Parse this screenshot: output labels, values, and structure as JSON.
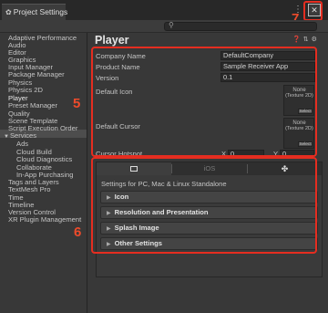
{
  "window": {
    "tab_title": "Project Settings",
    "tab_icon": "gear-icon",
    "menu_glyph": "⋮",
    "close_glyph": "✕"
  },
  "search": {
    "placeholder": "",
    "icon": "search-icon"
  },
  "sidebar": {
    "items": [
      {
        "label": "Adaptive Performance"
      },
      {
        "label": "Audio"
      },
      {
        "label": "Editor"
      },
      {
        "label": "Graphics"
      },
      {
        "label": "Input Manager"
      },
      {
        "label": "Package Manager"
      },
      {
        "label": "Physics"
      },
      {
        "label": "Physics 2D"
      },
      {
        "label": "Player",
        "selected": true
      },
      {
        "label": "Preset Manager"
      },
      {
        "label": "Quality"
      },
      {
        "label": "Scene Template"
      },
      {
        "label": "Script Execution Order"
      },
      {
        "label": "Services",
        "expanded": true
      },
      {
        "label": "Ads",
        "sub": true
      },
      {
        "label": "Cloud Build",
        "sub": true
      },
      {
        "label": "Cloud Diagnostics",
        "sub": true
      },
      {
        "label": "Collaborate",
        "sub": true
      },
      {
        "label": "In-App Purchasing",
        "sub": true
      },
      {
        "label": "Tags and Layers"
      },
      {
        "label": "TextMesh Pro"
      },
      {
        "label": "Time"
      },
      {
        "label": "Timeline"
      },
      {
        "label": "Version Control"
      },
      {
        "label": "XR Plugin Management"
      }
    ]
  },
  "player": {
    "title": "Player",
    "header_icons": [
      "help-icon",
      "settings-icon",
      "menu-icon"
    ],
    "company_name_label": "Company Name",
    "company_name_value": "DefaultCompany",
    "product_name_label": "Product Name",
    "product_name_value": "Sample Receiver App",
    "version_label": "Version",
    "version_value": "0.1",
    "default_icon_label": "Default Icon",
    "default_icon": {
      "none": "None",
      "type": "(Texture 2D)",
      "select": "Select"
    },
    "default_cursor_label": "Default Cursor",
    "default_cursor": {
      "none": "None",
      "type": "(Texture 2D)",
      "select": "Select"
    },
    "cursor_hotspot_label": "Cursor Hotspot",
    "hotspot_x_label": "X",
    "hotspot_x_value": "0",
    "hotspot_y_label": "Y",
    "hotspot_y_value": "0"
  },
  "platform": {
    "tabs": [
      {
        "label": "",
        "icon": "monitor-icon",
        "active": true
      },
      {
        "label": "iOS",
        "active": false
      },
      {
        "label": "",
        "icon": "android-icon",
        "active": false
      }
    ],
    "settings_for": "Settings for PC, Mac & Linux Standalone",
    "sections": [
      {
        "label": "Icon"
      },
      {
        "label": "Resolution and Presentation"
      },
      {
        "label": "Splash Image"
      },
      {
        "label": "Other Settings"
      }
    ]
  },
  "annotations": {
    "close_number": "7",
    "fields_number": "5",
    "sidebar_number": "6",
    "highlight_color": "#e52d20"
  }
}
